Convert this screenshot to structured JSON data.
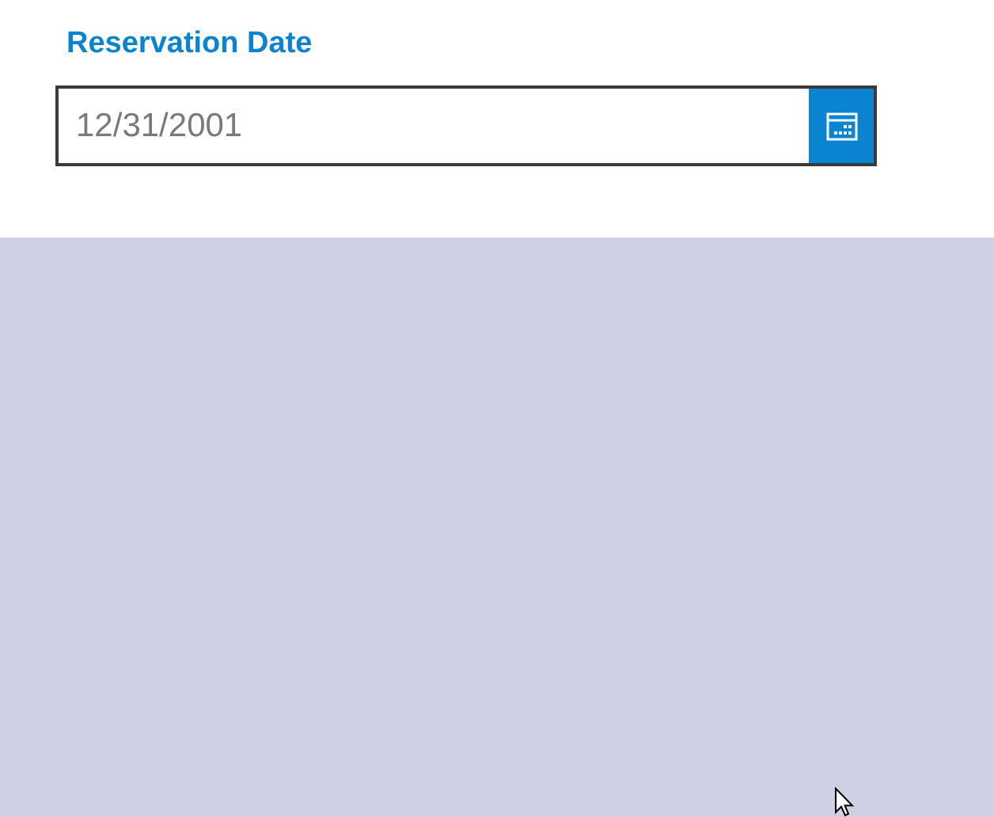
{
  "field": {
    "label": "Reservation Date",
    "placeholder": "12/31/2001"
  }
}
